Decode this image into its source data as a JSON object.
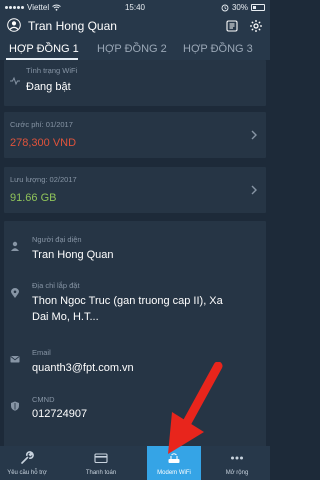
{
  "status": {
    "carrier": "Viettel",
    "time": "15:40",
    "battery": "30%"
  },
  "header": {
    "title": "Tran Hong Quan"
  },
  "tabs": [
    {
      "label": "HỢP ĐỒNG 1"
    },
    {
      "label": "HỢP ĐỒNG 2"
    },
    {
      "label": "HỢP ĐỒNG 3"
    }
  ],
  "wifi": {
    "label": "Tình trạng WiFi",
    "value": "Đang bật"
  },
  "fee": {
    "label": "Cước phí: 01/2017",
    "value": "278,300 VND"
  },
  "usage": {
    "label": "Lưu lượng: 02/2017",
    "value": "91.66 GB"
  },
  "info": {
    "rep_label": "Người đại diện",
    "rep_value": "Tran Hong Quan",
    "addr_label": "Địa chỉ lắp đặt",
    "addr_value_1": "Thon Ngoc Truc (gan truong cap II), Xa",
    "addr_value_2": "Dai Mo, H.T...",
    "email_label": "Email",
    "email_value": "quanth3@fpt.com.vn",
    "id_label": "CMND",
    "id_value": "012724907"
  },
  "nav": [
    {
      "label": "Yêu cầu hỗ trợ"
    },
    {
      "label": "Thanh toán"
    },
    {
      "label": "Modem WiFi"
    },
    {
      "label": "Mở rộng"
    }
  ],
  "colors": {
    "accent": "#35a4e6",
    "fee": "#e0533b",
    "usage": "#8fc35a",
    "arrow": "#e8251c"
  }
}
